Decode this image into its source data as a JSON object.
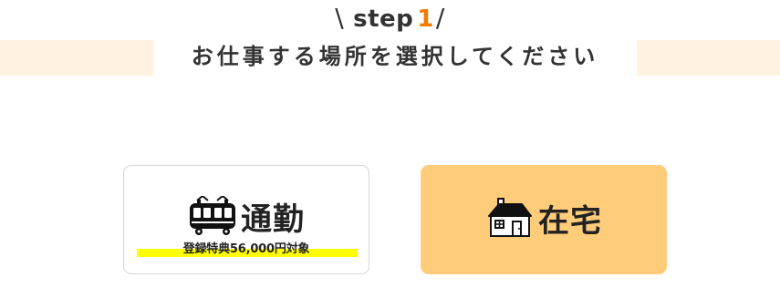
{
  "header": {
    "step_prefix": "\\",
    "step_word": "step",
    "step_number": "1",
    "step_suffix": "/",
    "title": "お仕事する場所を選択してください"
  },
  "options": [
    {
      "label": "通勤",
      "icon": "train-icon",
      "bonus": "登録特典56,000円対象"
    },
    {
      "label": "在宅",
      "icon": "house-icon"
    }
  ],
  "colors": {
    "accent_orange": "#f07c00",
    "band_bg": "#fff2e1",
    "home_card_bg": "#ffcd7a",
    "highlight_yellow": "#ffff00",
    "text_dark": "#333333"
  }
}
